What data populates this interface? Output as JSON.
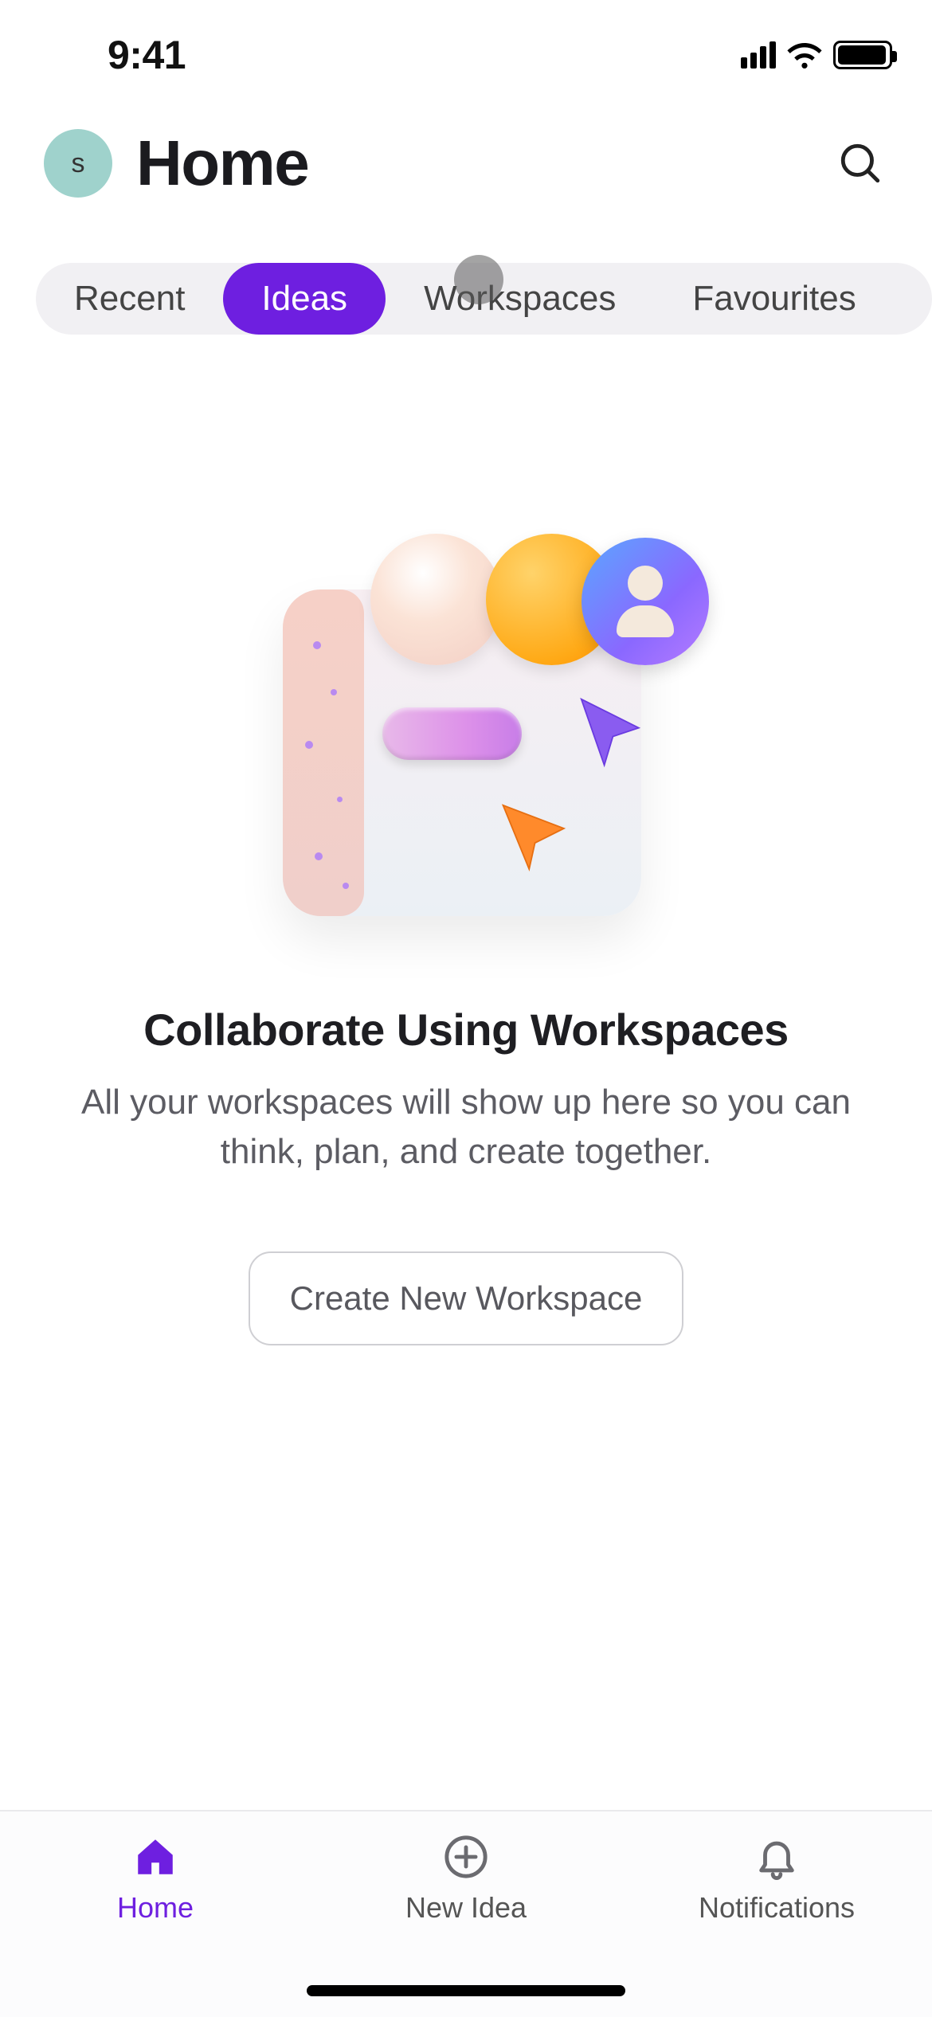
{
  "status": {
    "time": "9:41"
  },
  "header": {
    "avatar_initial": "s",
    "title": "Home"
  },
  "tabs": {
    "items": [
      {
        "label": "Recent",
        "active": false
      },
      {
        "label": "Ideas",
        "active": true
      },
      {
        "label": "Workspaces",
        "active": false
      },
      {
        "label": "Favourites",
        "active": false
      }
    ]
  },
  "empty_state": {
    "title": "Collaborate Using Workspaces",
    "subtitle": "All your workspaces will show up here so you can think, plan, and create together.",
    "cta_label": "Create New Workspace"
  },
  "tabbar": {
    "items": [
      {
        "label": "Home",
        "active": true
      },
      {
        "label": "New Idea",
        "active": false
      },
      {
        "label": "Notifications",
        "active": false
      }
    ]
  },
  "colors": {
    "accent": "#6e1fe0"
  }
}
